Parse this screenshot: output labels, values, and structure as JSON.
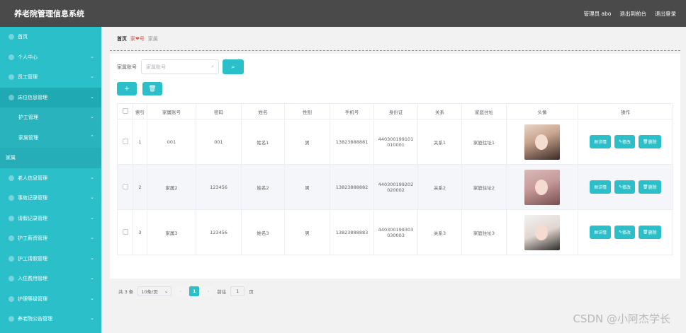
{
  "header": {
    "title": "养老院管理信息系统",
    "admin_label": "管理员 abo",
    "to_front": "退出到前台",
    "logout": "退出登录"
  },
  "sidebar": {
    "items": [
      {
        "label": "首页"
      },
      {
        "label": "个人中心"
      },
      {
        "label": "员工管理"
      },
      {
        "label": "床位信息管理"
      },
      {
        "label": "护工管理"
      },
      {
        "label": "家属管理"
      },
      {
        "label": "家属"
      },
      {
        "label": "老人信息管理"
      },
      {
        "label": "事故记录管理"
      },
      {
        "label": "请假记录管理"
      },
      {
        "label": "护工薪资管理"
      },
      {
        "label": "护工请假管理"
      },
      {
        "label": "入住费用管理"
      },
      {
        "label": "护理等级管理"
      },
      {
        "label": "养老院公告管理"
      }
    ]
  },
  "breadcrumb": {
    "home": "首页",
    "mid": "家❤号",
    "current": "家属"
  },
  "search": {
    "label": "家属账号",
    "placeholder": "家属账号"
  },
  "toolbar": {
    "add_label": "+",
    "delete_label": "🗑"
  },
  "table": {
    "headers": [
      "",
      "索引",
      "家属账号",
      "密码",
      "姓名",
      "性别",
      "手机号",
      "身份证",
      "关系",
      "家庭住址",
      "头像",
      "操作"
    ],
    "rows": [
      {
        "idx": "1",
        "account": "001",
        "password": "001",
        "name": "姓名1",
        "gender": "男",
        "phone": "13823888881",
        "idcard1": "440300199101",
        "idcard2": "010001",
        "relation": "关系1",
        "address": "家庭住址1"
      },
      {
        "idx": "2",
        "account": "家属2",
        "password": "123456",
        "name": "姓名2",
        "gender": "男",
        "phone": "13823888882",
        "idcard1": "440300199202",
        "idcard2": "020002",
        "relation": "关系2",
        "address": "家庭住址2"
      },
      {
        "idx": "3",
        "account": "家属3",
        "password": "123456",
        "name": "姓名3",
        "gender": "男",
        "phone": "13823888883",
        "idcard1": "440300199303",
        "idcard2": "030003",
        "relation": "关系3",
        "address": "家庭住址3"
      }
    ],
    "op_detail": "详情",
    "op_edit": "修改",
    "op_delete": "删除"
  },
  "pager": {
    "total": "共 3 条",
    "page_size": "10条/页",
    "current": "1",
    "goto_label": "前往",
    "goto_value": "1",
    "page_unit": "页"
  },
  "watermark": "CSDN @小阿杰学长",
  "colors": {
    "accent": "#2bbfc9",
    "topbar": "#4a4a4a"
  }
}
